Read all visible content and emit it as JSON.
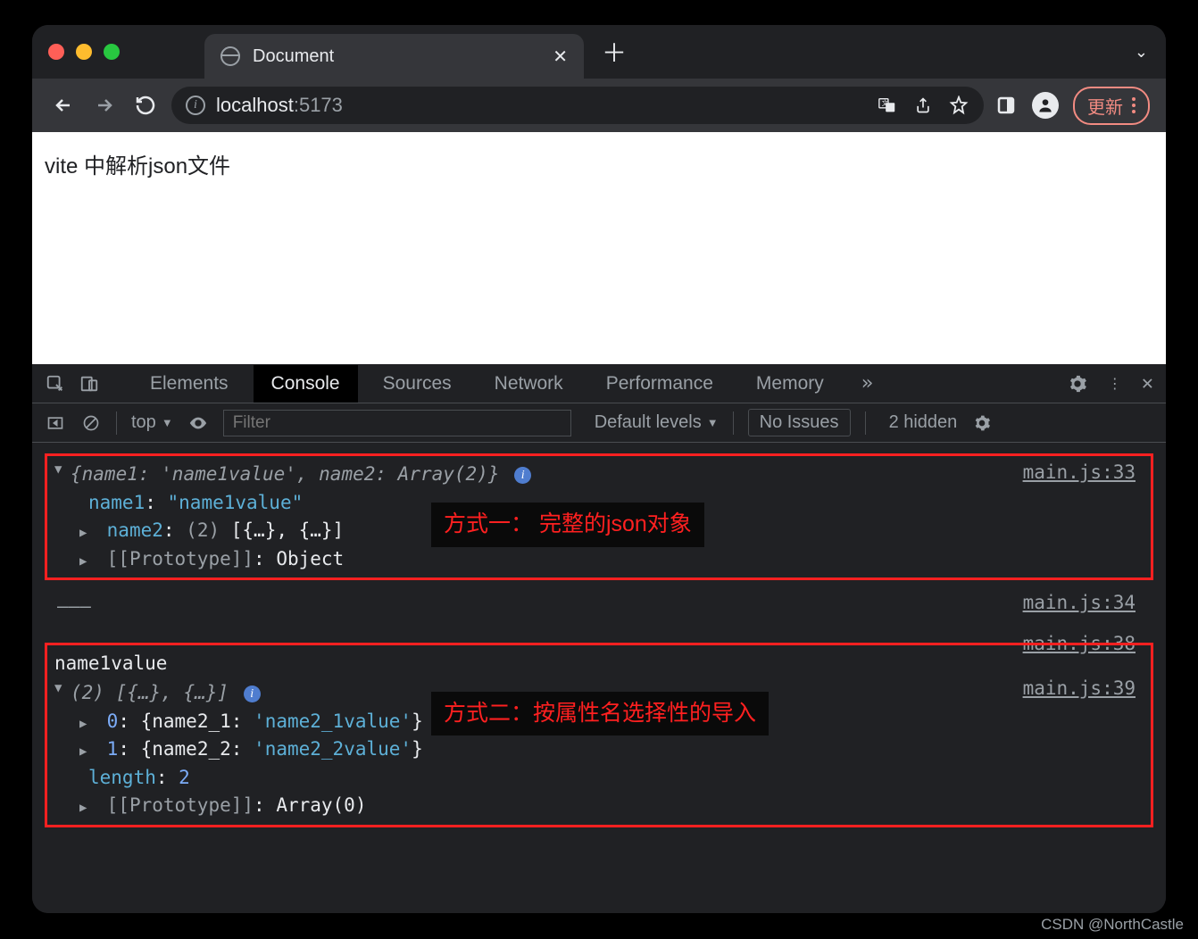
{
  "window": {
    "tab_title": "Document",
    "url_host": "localhost",
    "url_port": ":5173",
    "update_label": "更新"
  },
  "page": {
    "heading": "vite 中解析json文件"
  },
  "devtools": {
    "tabs": [
      "Elements",
      "Console",
      "Sources",
      "Network",
      "Performance",
      "Memory"
    ],
    "active_tab": "Console",
    "more": "»"
  },
  "console_toolbar": {
    "context": "top",
    "filter_placeholder": "Filter",
    "levels": "Default levels",
    "issues": "No Issues",
    "hidden": "2 hidden"
  },
  "logs": {
    "box1": {
      "source": "main.js:33",
      "summary_pre": "{name1: ",
      "summary_val1": "'name1value'",
      "summary_mid": ", name2: ",
      "summary_val2": "Array(2)",
      "summary_post": "}",
      "line1_key": "name1",
      "line1_val": "\"name1value\"",
      "line2_key": "name2",
      "line2_count": "(2)",
      "line2_val": "[{…}, {…}]",
      "proto_key": "[[Prototype]]",
      "proto_val": "Object",
      "annotation": "方式一： 完整的json对象"
    },
    "sep": {
      "text": "———",
      "source": "main.js:34"
    },
    "line3": {
      "text": "name1value",
      "source": "main.js:38"
    },
    "box2": {
      "source": "main.js:39",
      "summary_count": "(2)",
      "summary_arr": "[{…}, {…}]",
      "idx0_key": "0",
      "idx0_obj": "{name2_1: ",
      "idx0_val": "'name2_1value'",
      "idx0_close": "}",
      "idx1_key": "1",
      "idx1_obj": "{name2_2: ",
      "idx1_val": "'name2_2value'",
      "idx1_close": "}",
      "len_key": "length",
      "len_val": "2",
      "proto_key": "[[Prototype]]",
      "proto_val": "Array(0)",
      "annotation": "方式二：按属性名选择性的导入"
    }
  },
  "watermark": "CSDN @NorthCastle"
}
